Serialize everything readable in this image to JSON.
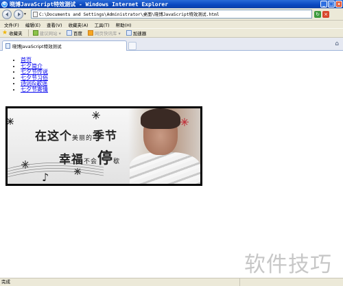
{
  "window": {
    "title": "晓博JavaScript特效测试 - Windows Internet Explorer"
  },
  "address": {
    "url": "C:\\Documents and Settings\\Administrator\\桌面\\晓博JavaScript特效测试.html"
  },
  "menu": [
    "文件(F)",
    "编辑(E)",
    "查看(V)",
    "收藏夹(A)",
    "工具(T)",
    "帮助(H)"
  ],
  "favorites": {
    "label": "收藏夹",
    "items": [
      {
        "label": "建议网站 ▾",
        "dim": true
      },
      {
        "label": "百度",
        "dim": false
      },
      {
        "label": "网页快讯库 ▾",
        "dim": true
      },
      {
        "label": "加速器",
        "dim": false
      }
    ]
  },
  "tab": {
    "label": "晓博JavaScript特效测试"
  },
  "links": [
    "首页",
    "七夕简介",
    "七夕节传说",
    "七夕节习俗",
    "诗词&歌谣",
    "七夕节寄情"
  ],
  "banner": {
    "line1_a": "在这个",
    "line1_b": "美丽的",
    "line1_c": "季节",
    "line2_a": "幸福",
    "line2_b": "不会",
    "line2_c": "停",
    "line2_d": "歇"
  },
  "watermark": "软件技巧",
  "status": {
    "text": "完成"
  }
}
